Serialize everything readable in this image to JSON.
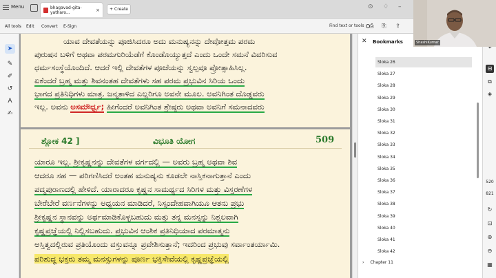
{
  "titlebar": {
    "menu_label": "Menu",
    "tab_title": "bhagavad-gita-yatharo...",
    "tab_close": "×",
    "create_label": "Create",
    "plus": "+"
  },
  "menubar": {
    "items": [
      "All tools",
      "Edit",
      "Convert",
      "E-Sign"
    ],
    "find_label": "Find text or tools"
  },
  "page1": {
    "lines": [
      "ಯಾವ ದೇವತೆಯನ್ನು ಪೂಜಿಸಿದರೂ ಅದು ಮನುಷ್ಯನನ್ನು ದೇವೋತ್ತಮ ಪರಮ",
      "ಪುರುಷನ ಬಳಿಗೆ ಅಥವಾ ಪರಮಗುರಿಯೆಡೆಗೆ ಕೊಂಡೊಯ್ಯುತ್ತದೆ ಎಂದು ಒಂದೇ ಸಮನೆ ವಿವರಿಸುವ",
      "ಧರ್ಮಸಂಸ್ಥೆಯೊಂದಿದೆ. ಆದರೆ ಇಲ್ಲಿ ದೇವತೆಗಳ ಪೂಜೆಯನ್ನು ಸ್ವಲ್ಪವೂ ಪ್ರೋತ್ಸಾಹಿಸಿಲ್ಲ.",
      "ಏಕೆಂದರೆ ಬ್ರಹ್ಮ ಮತ್ತು ಶಿವನಂತಹ ದೇವತೆಗಳು ಸಹ ಪರಮ ಪ್ರಭುವಿನ ಸಿರಿಯ ಒಂದು",
      "ಭಾಗದ ಪ್ರತಿನಿಧಿಗಳು ಮಾತ್ರ. ಜನ್ಮತಾಳಿದ ಎಲ್ಲರಿಗೂ ಅವನೇ ಮೂಲ. ಅವನಿಗಿಂತ ದೊಡ್ಡವರು",
      "ಇಲ್ಲ. ಅವನು",
      "ಅಸಮೌರ್ಧ್ವ;",
      "ಹೀಗೆಂದರೆ ಅವನಿಗಿಂತ ಶ್ರೇಷ್ಠರು ಅಥವಾ ಅವನಿಗೆ ಸಮನಾದವರು"
    ]
  },
  "page2": {
    "header_left": "ಶ್ಲೋಕ 42 ]",
    "header_mid": "ವಿಭೂತಿ ಯೋಗ",
    "page_number": "509",
    "lines": [
      "ಯಾರೂ ಇಲ್ಲ. ಶ್ರೀಕೃಷ್ಣನನ್ನು ದೇವತೆಗಳ ವರ್ಗದಲ್ಲಿ — ಅವರು ಬ್ರಹ್ಮ ಅಥವಾ ಶಿವ",
      "ಆದರೂ ಸಹ — ಪರಿಗಣಿಸಿದರೆ ಅಂತಹ ಮನುಷ್ಯನು ಕೂಡಲೇ ನಾಸ್ತಿಕನಾಗುತ್ತಾನೆ ಎಂದು",
      "ಪದ್ಮಪುರಾಣದಲ್ಲಿ ಹೇಳಿದೆ. ಯಾರಾದರೂ ಕೃಷ್ಣನ ಸಾಮರ್ಥ್ಯದ ಸಿರಿಗಳ ಮತ್ತು ವಿಸ್ತರಣೆಗಳ",
      "ಬೇರೆಬೇರೆ ವರ್ಣನೆಗಳನ್ನು ಅಧ್ಯಯನ ಮಾಡಿದರೆ, ನಿಸ್ಸಂದೇಹವಾಗಿಯೂ ಆತನು ಪ್ರಭು",
      "ಶ್ರೀಕೃಷ್ಣನ ಸ್ಥಾನವನ್ನು ಅರ್ಥಮಾಡಿಕೊಳ್ಳಬಹುದು ಮತ್ತು ತನ್ನ ಮನಸ್ಸನ್ನು ನಿಶ್ಚಲವಾಗಿ",
      "ಕೃಷ್ಣಪ್ರಜ್ಞೆಯಲ್ಲಿ ನಿಲ್ಲಿಸಬಹುದು. ಪ್ರಭುವಿನ ಆಂಶಿಕ ಪ್ರತಿನಿಧಿಯಾದ ಪರಮಾತ್ಮನು",
      "ಅಸ್ತಿತ್ವದಲ್ಲಿರುವ ಪ್ರತಿಯೊಂದು ವಸ್ತುವನ್ನೂ ಪ್ರವೇಶಿಸುತ್ತಾನೆ; ಇದರಿಂದ ಪ್ರಭುವು ಸರ್ವಾಂತರ್ಯಾಮಿ.",
      "ಪರಿಶುದ್ಧ ಭಕ್ತರು ತಮ್ಮ ಮನಸ್ಸುಗಳನ್ನು ಪೂರ್ಣ ಭಕ್ತಿಸೇವೆಯಲ್ಲಿ ಕೃಷ್ಣಪ್ರಜ್ಞೆಯಲ್ಲಿ"
    ]
  },
  "bookmarks": {
    "title": "Bookmarks",
    "items": [
      "Sloka 26",
      "Sloka 27",
      "Sloka 28",
      "Sloka 29",
      "Sloka 30",
      "Sloka 31",
      "Sloka 32",
      "Sloka 33",
      "Sloka 34",
      "Sloka 35",
      "Sloka 36",
      "Sloka 37",
      "Sloka 38",
      "Sloka 39",
      "Sloka 40",
      "Sloka 41",
      "Sloka 42"
    ],
    "selected": "Sloka 26",
    "chapter": "Chapter 11"
  },
  "right_rail": {
    "page_current": "520",
    "page_total": "821"
  },
  "webcam": {
    "name": "ShashiKumar"
  },
  "colors": {
    "page_bg": "#fbf3dc",
    "underline_green": "#27a844",
    "underline_red": "#cf2525",
    "highlight_yellow": "#f7e86a",
    "header_green": "#2b7a2b"
  }
}
